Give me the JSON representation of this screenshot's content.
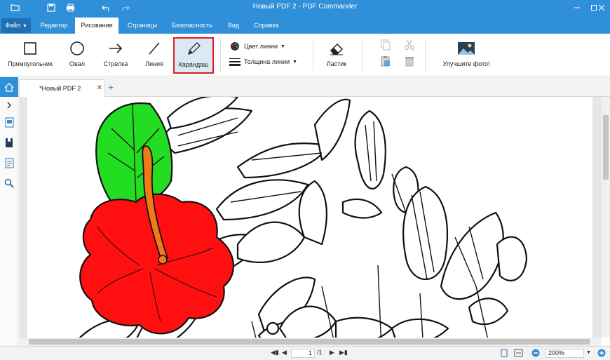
{
  "window": {
    "title": "Новый PDF 2 - PDF Commander"
  },
  "tabs": [
    {
      "label": "Файл"
    },
    {
      "label": "Редактор"
    },
    {
      "label": "Рисование"
    },
    {
      "label": "Страницы"
    },
    {
      "label": "Безопасность"
    },
    {
      "label": "Вид"
    },
    {
      "label": "Справка"
    }
  ],
  "ribbon": {
    "rectangle": "Прямоугольник",
    "oval": "Овал",
    "arrow": "Стрелка",
    "line": "Линия",
    "pencil": "Карандаш",
    "line_color": "Цвет линии",
    "line_width": "Толщина линии",
    "eraser": "Ластик",
    "enhance_photo": "Улучшите фото!"
  },
  "document": {
    "tab_name": "*Новый PDF 2"
  },
  "status": {
    "current_page": "1",
    "total_pages": "/1",
    "zoom": "200%"
  },
  "colors": {
    "accent": "#2f8fd8",
    "highlight": "#e11d1d",
    "flower_red": "#ff0f0f",
    "leaf_green": "#22dd22",
    "stamen_orange": "#f07a1a"
  }
}
